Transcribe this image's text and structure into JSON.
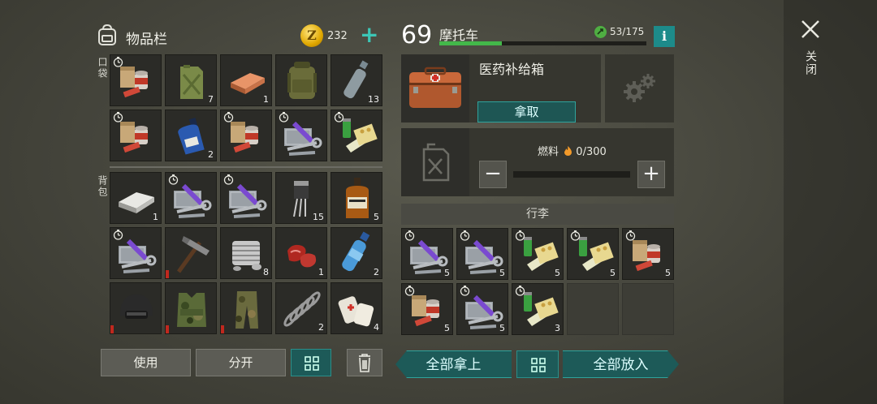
{
  "inventory": {
    "title": "物品栏",
    "coins": "232",
    "pocket_label": "口袋",
    "backpack_label": "背包",
    "pocket_items": [
      {
        "icon": "food",
        "qty": "",
        "timer": true
      },
      {
        "icon": "jerrycan",
        "qty": "7"
      },
      {
        "icon": "copper-bar",
        "qty": "1"
      },
      {
        "icon": "backpack",
        "qty": ""
      },
      {
        "icon": "water-bottle-empty",
        "qty": "13"
      },
      {
        "icon": "food",
        "qty": "",
        "timer": true
      },
      {
        "icon": "blue-bottle",
        "qty": "2"
      },
      {
        "icon": "food",
        "qty": "",
        "timer": true
      },
      {
        "icon": "toolkit",
        "qty": "",
        "timer": true
      },
      {
        "icon": "medicine",
        "qty": "",
        "timer": true
      }
    ],
    "backpack_items": [
      {
        "icon": "iron-bar",
        "qty": "1"
      },
      {
        "icon": "toolkit",
        "qty": "",
        "timer": true
      },
      {
        "icon": "toolkit",
        "qty": "",
        "timer": true
      },
      {
        "icon": "transistor",
        "qty": "15"
      },
      {
        "icon": "whiskey",
        "qty": "5"
      },
      {
        "icon": "toolkit",
        "qty": "",
        "timer": true
      },
      {
        "icon": "hammer",
        "qty": "",
        "durability": true
      },
      {
        "icon": "engine-part",
        "qty": "8"
      },
      {
        "icon": "raw-meat",
        "qty": "1"
      },
      {
        "icon": "water-bottle",
        "qty": "2"
      },
      {
        "icon": "helmet",
        "qty": "",
        "durability": true
      },
      {
        "icon": "camo-vest",
        "qty": "",
        "durability": true
      },
      {
        "icon": "camo-pants",
        "qty": "",
        "durability": true
      },
      {
        "icon": "spring",
        "qty": "2"
      },
      {
        "icon": "bandage",
        "qty": "4"
      }
    ],
    "use_label": "使用",
    "split_label": "分开"
  },
  "vehicle": {
    "level": "69",
    "name": "摩托车",
    "progress": 0.3,
    "capacity": "53/175",
    "info": "i",
    "container_title": "医药补给箱",
    "take_label": "拿取",
    "fuel_label": "燃料",
    "fuel_value": "0/300",
    "luggage_label": "行李",
    "luggage_items": [
      {
        "icon": "toolkit",
        "qty": "5",
        "timer": true
      },
      {
        "icon": "toolkit",
        "qty": "5",
        "timer": true
      },
      {
        "icon": "medicine",
        "qty": "5",
        "timer": true
      },
      {
        "icon": "medicine",
        "qty": "5",
        "timer": true
      },
      {
        "icon": "food",
        "qty": "5",
        "timer": true
      },
      {
        "icon": "food",
        "qty": "5",
        "timer": true
      },
      {
        "icon": "toolkit",
        "qty": "5",
        "timer": true
      },
      {
        "icon": "medicine",
        "qty": "3",
        "timer": true
      },
      {
        "icon": "",
        "qty": ""
      },
      {
        "icon": "",
        "qty": ""
      }
    ],
    "take_all_label": "全部拿上",
    "put_all_label": "全部放入"
  },
  "close_label": "关闭"
}
